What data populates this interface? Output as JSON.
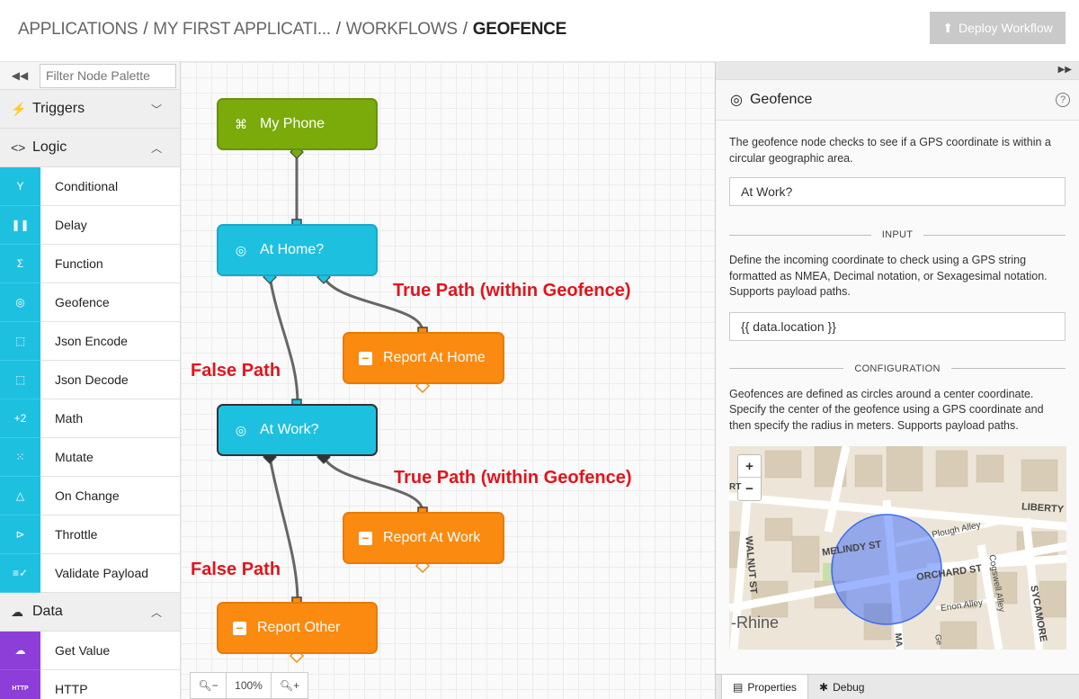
{
  "header": {
    "breadcrumb": [
      "APPLICATIONS",
      "MY FIRST APPLICATI...",
      "WORKFLOWS"
    ],
    "current": "GEOFENCE",
    "separator": "/",
    "deploy_label": "Deploy Workflow",
    "deploy_icon": "upload-icon"
  },
  "sidebar": {
    "filter_placeholder": "Filter Node Palette",
    "categories": {
      "triggers": "Triggers",
      "logic": "Logic",
      "data": "Data"
    },
    "logic_items": [
      {
        "label": "Conditional",
        "icon": "branch-icon"
      },
      {
        "label": "Delay",
        "icon": "pause-icon"
      },
      {
        "label": "Function",
        "icon": "sigma-icon"
      },
      {
        "label": "Geofence",
        "icon": "crosshair-icon"
      },
      {
        "label": "Json Encode",
        "icon": "json-encode-icon"
      },
      {
        "label": "Json Decode",
        "icon": "json-decode-icon"
      },
      {
        "label": "Math",
        "icon": "math-icon"
      },
      {
        "label": "Mutate",
        "icon": "mutate-icon"
      },
      {
        "label": "On Change",
        "icon": "triangle-icon"
      },
      {
        "label": "Throttle",
        "icon": "throttle-icon"
      },
      {
        "label": "Validate Payload",
        "icon": "validate-icon"
      }
    ],
    "data_items": [
      {
        "label": "Get Value",
        "icon": "cloud-download-icon"
      },
      {
        "label": "HTTP",
        "icon": "http-icon"
      }
    ]
  },
  "canvas": {
    "nodes": {
      "my_phone": "My Phone",
      "at_home": "At Home?",
      "report_home": "Report At Home",
      "at_work": "At Work?",
      "report_work": "Report At Work",
      "report_other": "Report Other"
    },
    "annotations": {
      "true_path": "True Path (within Geofence)",
      "false_path": "False Path"
    },
    "zoom_level": "100%",
    "colors": {
      "trigger": "#7aab0b",
      "logic": "#1ec0e0",
      "output": "#fb8a10",
      "annotation": "#e3141b"
    }
  },
  "panel": {
    "title": "Geofence",
    "description": "The geofence node checks to see if a GPS coordinate is within a circular geographic area.",
    "name_value": "At Work?",
    "input_label": "INPUT",
    "input_desc": "Define the incoming coordinate to check using a GPS string formatted as NMEA, Decimal notation, or Sexagesimal notation. Supports payload paths.",
    "input_value": "{{ data.location }}",
    "config_label": "CONFIGURATION",
    "config_desc": "Geofences are defined as circles around a center coordinate. Specify the center of the geofence using a GPS coordinate and then specify the radius in meters. Supports payload paths.",
    "map": {
      "zoom_in": "+",
      "zoom_out": "−",
      "labels": {
        "liberty": "LIBERTY",
        "plough": "Plough Alley",
        "melindy": "MELINDY ST",
        "orchard": "ORCHARD ST",
        "cogswell": "Cogswell Alley",
        "walnut": "WALNUT ST",
        "enon": "Enon Alley",
        "sycamore": "SYCAMORE",
        "rhine": "-Rhine",
        "rt": "RT",
        "ma": "MA",
        "ge": "Ge"
      }
    },
    "tabs": [
      "Properties",
      "Debug"
    ]
  }
}
